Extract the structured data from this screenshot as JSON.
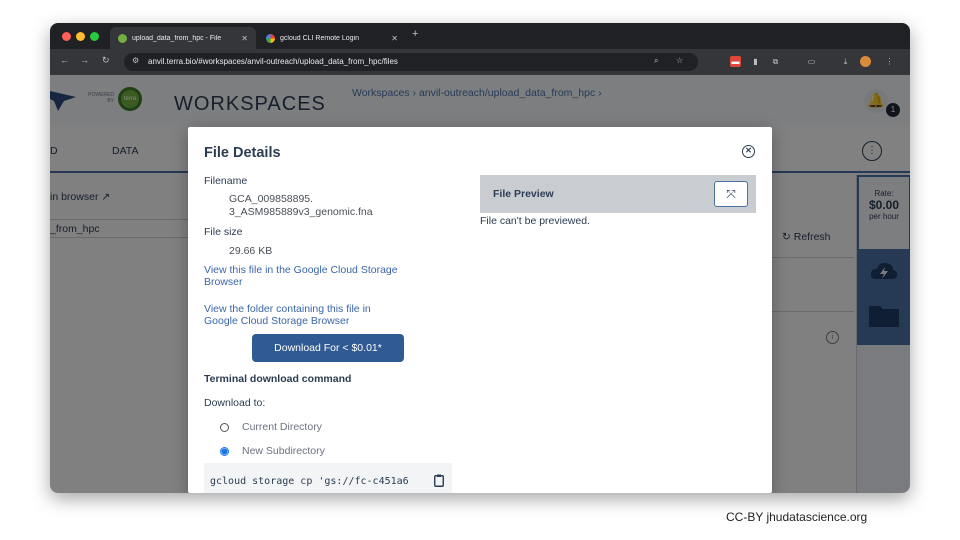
{
  "browser": {
    "tabs": [
      {
        "label": "upload_data_from_hpc - File",
        "active": true
      },
      {
        "label": "gcloud CLI Remote Login",
        "active": false
      }
    ],
    "new_tab_label": "+",
    "url": "anvil.terra.bio/#workspaces/anvil-outreach/upload_data_from_hpc/files"
  },
  "app": {
    "powered_by": "POWERED BY",
    "terra_badge": "terra",
    "title": "WORKSPACES",
    "breadcrumbs": "Workspaces › anvil-outreach/upload_data_from_hpc ›",
    "notification_count": "1",
    "tabs": [
      "D",
      "DATA"
    ],
    "open_in_browser": "in browser",
    "path_fragment": "_from_hpc",
    "refresh_label": "Refresh",
    "rate": {
      "label": "Rate:",
      "value": "$0.00",
      "unit": "per hour"
    }
  },
  "modal": {
    "title": "File Details",
    "filename_label": "Filename",
    "filename_line1": "GCA_009858895.",
    "filename_line2": "3_ASM985889v3_genomic.fna",
    "filesize_label": "File size",
    "filesize_value": "29.66 KB",
    "link_storage_line1": "View this file in the Google Cloud Storage",
    "link_storage_line2": "Browser",
    "link_folder_line1": "View the folder containing this file in",
    "link_folder_line2": "Google Cloud Storage Browser",
    "download_button": "Download For < $0.01*",
    "terminal_label": "Terminal download command",
    "download_to_label": "Download to:",
    "radio_options": [
      "Current Directory",
      "New Subdirectory"
    ],
    "selected_option": "New Subdirectory",
    "command": "gcloud storage cp 'gs://fc-c451a6",
    "preview_title": "File Preview",
    "preview_message": "File can't be previewed."
  },
  "credit": "CC-BY jhudatascience.org",
  "colors": {
    "primary": "#2f5a93",
    "link": "#3b66a8",
    "text": "#2c3c52",
    "terra_green": "#74ae43"
  }
}
